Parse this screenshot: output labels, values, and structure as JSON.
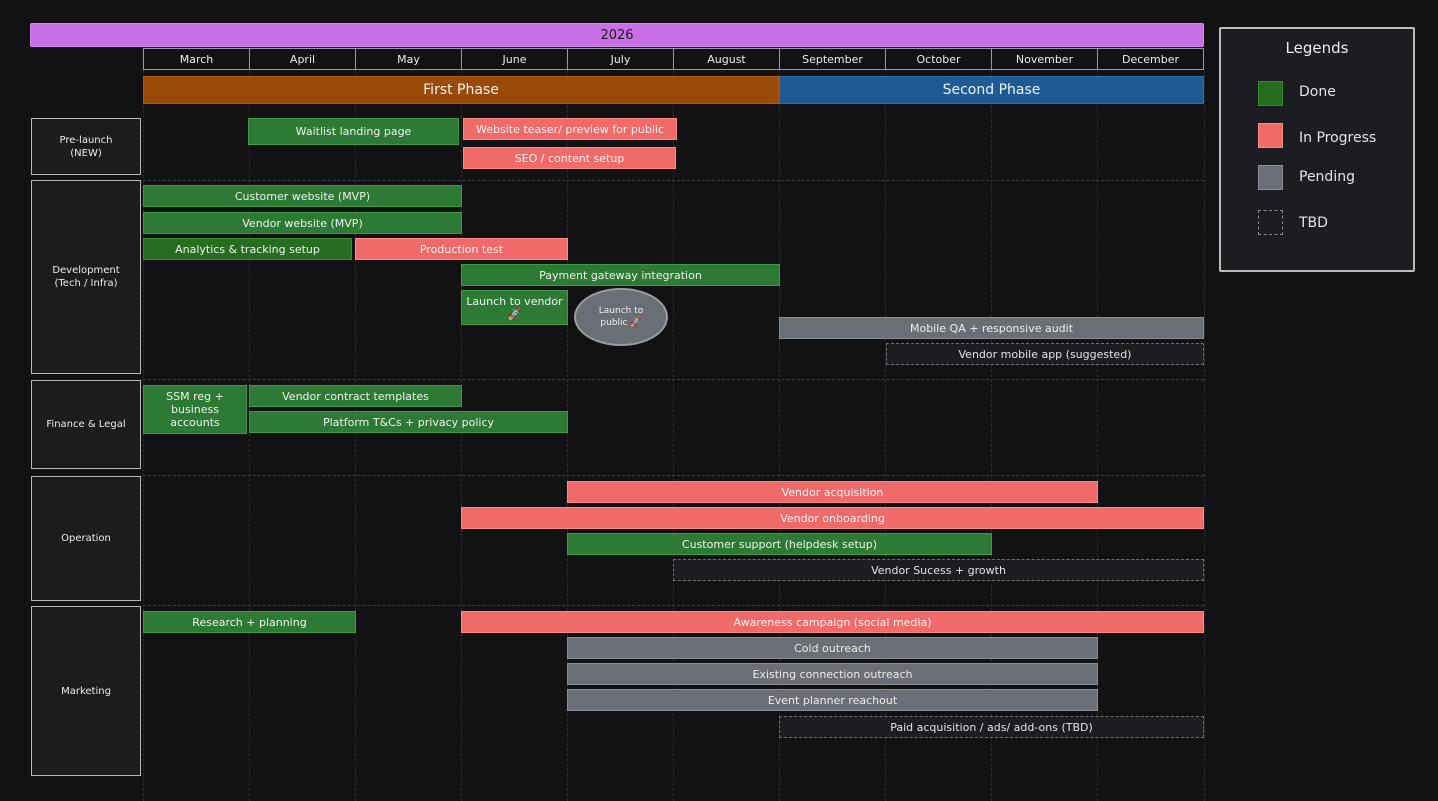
{
  "year": "2026",
  "months": [
    "March",
    "April",
    "May",
    "June",
    "July",
    "August",
    "September",
    "October",
    "November",
    "December"
  ],
  "phases": {
    "first": "First Phase",
    "second": "Second Phase"
  },
  "categories": {
    "prelaunch": "Pre-launch\n(NEW)",
    "development": "Development\n(Tech / Infra)",
    "finance": "Finance & Legal",
    "operation": "Operation",
    "marketing": "Marketing"
  },
  "tasks": {
    "waitlist": "Waitlist landing page",
    "teaser": "Website teaser/ preview for public",
    "seo": "SEO / content setup",
    "customer_web": "Customer website (MVP)",
    "vendor_web": "Vendor website (MVP)",
    "analytics": "Analytics & tracking setup",
    "prod_test": "Production test",
    "payment": "Payment gateway integration",
    "launch_vendor": "Launch to vendor 🚀",
    "launch_public": "Launch to public 🚀",
    "mobile_qa": "Mobile QA + responsive audit",
    "vendor_app": "Vendor mobile app (suggested)",
    "ssm": "SSM reg + business accounts",
    "contract": "Vendor contract templates",
    "tnc": "Platform T&Cs + privacy policy",
    "vendor_acq": "Vendor acquisition",
    "vendor_onb": "Vendor onboarding",
    "cust_support": "Customer support (helpdesk setup)",
    "vendor_success": "Vendor Sucess + growth",
    "research": "Research + planning",
    "awareness": "Awareness campaign (social media)",
    "cold": "Cold outreach",
    "existing": "Existing connection outreach",
    "event": "Event planner reachout",
    "paid": "Paid acquisition / ads/ add-ons (TBD)"
  },
  "legend": {
    "title": "Legends",
    "items": [
      {
        "label": "Done",
        "color": "#276d1f"
      },
      {
        "label": "In Progress",
        "color": "#f06a6a"
      },
      {
        "label": "Pending",
        "color": "#6b6e74"
      },
      {
        "label": "TBD",
        "color": "transparent"
      }
    ]
  }
}
